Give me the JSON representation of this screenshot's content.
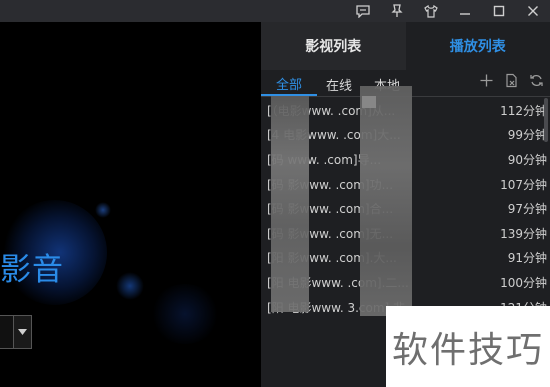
{
  "window": {
    "icons": [
      "chat-icon",
      "pin-icon",
      "skin-icon",
      "minimize-icon",
      "maximize-icon",
      "close-icon"
    ]
  },
  "video": {
    "brand_text": "影音"
  },
  "panel": {
    "tabs": [
      {
        "label": "影视列表",
        "active": false
      },
      {
        "label": "播放列表",
        "active": true
      }
    ],
    "subtabs": [
      {
        "label": "全部",
        "active": true
      },
      {
        "label": "在线",
        "active": false
      },
      {
        "label": "本地",
        "active": false
      }
    ],
    "tools": [
      "add-icon",
      "delete-file-icon",
      "loop-icon"
    ],
    "items": [
      {
        "title": "[（电影www.        .com]从...",
        "duration": "112分钟"
      },
      {
        "title": "[4   电影www.        .com]大...",
        "duration": "99分钟"
      },
      {
        "title": "[码      www.        .com]导...",
        "duration": "90分钟"
      },
      {
        "title": "[码    影www.        .com]功...",
        "duration": "107分钟"
      },
      {
        "title": "[码    影www.        .com]合...",
        "duration": "97分钟"
      },
      {
        "title": "[码    影www.        .com]无...",
        "duration": "139分钟"
      },
      {
        "title": "[阳    影www.        .com].大...",
        "duration": "91分钟"
      },
      {
        "title": "[阳   电影www.        .com].二...",
        "duration": "100分钟"
      },
      {
        "title": "[阳   电影www.      3.com].非...",
        "duration": "121分钟"
      }
    ]
  },
  "watermark": "软件技巧"
}
